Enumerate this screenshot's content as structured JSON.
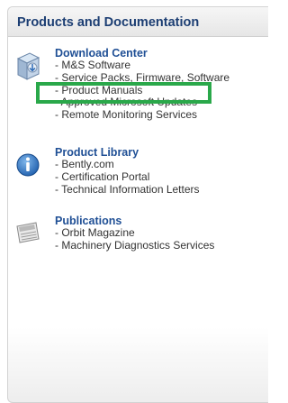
{
  "panel": {
    "title": "Products and Documentation"
  },
  "sections": [
    {
      "title": "Download Center",
      "icon": "download-box-icon",
      "links": [
        "- M&S Software",
        "- Service Packs, Firmware, Software",
        "- Product Manuals",
        "- Approved Microsoft Updates",
        "- Remote Monitoring Services"
      ]
    },
    {
      "title": "Product Library",
      "icon": "info-icon",
      "links": [
        "- Bently.com",
        "- Certification Portal",
        "- Technical Information Letters"
      ]
    },
    {
      "title": "Publications",
      "icon": "newspaper-icon",
      "links": [
        "- Orbit Magazine",
        "- Machinery Diagnostics Services"
      ]
    }
  ],
  "highlight": {
    "color": "#2aa84a",
    "target": "- Product Manuals"
  },
  "colors": {
    "header_text": "#1c3e73",
    "section_title": "#1f4f95",
    "link_text": "#333333"
  }
}
